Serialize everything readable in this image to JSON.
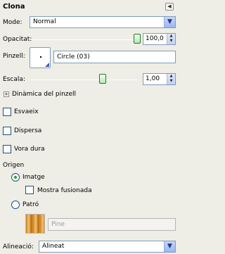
{
  "panel": {
    "title": "Clona"
  },
  "mode": {
    "label": "Mode:",
    "value": "Normal"
  },
  "opacity": {
    "label": "Opacitat:",
    "value": "100,0",
    "level_percent": 100
  },
  "brush": {
    "label": "Pinzell:",
    "name": "Circle (03)"
  },
  "scale": {
    "label": "Escala:",
    "value": "1,00"
  },
  "brush_dynamics": {
    "label": "Dinàmica del pinzell"
  },
  "options": [
    {
      "label": "Esvaeix",
      "checked": false
    },
    {
      "label": "Dispersa",
      "checked": false
    },
    {
      "label": "Vora dura",
      "checked": false
    }
  ],
  "source": {
    "label": "Origen",
    "image_label": "Imatge",
    "sample_merged_label": "Mostra fusionada",
    "pattern_label": "Patró",
    "pattern_name": "Pine",
    "selected": "image"
  },
  "alignment": {
    "label": "Alineació:",
    "value": "Alineat"
  }
}
